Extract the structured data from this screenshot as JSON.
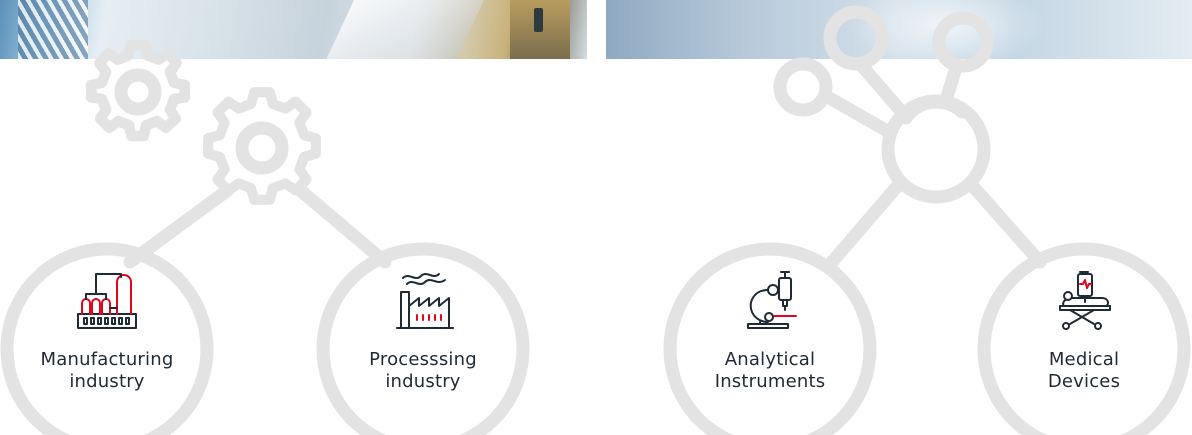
{
  "colors": {
    "ring": "#e3e3e3",
    "icon_stroke": "#1e2a35",
    "accent_red": "#e3051b",
    "text": "#1e2a35"
  },
  "categories": [
    {
      "line1": "Manufacturing",
      "line2": "industry",
      "icon": "manufacturing-plant-icon"
    },
    {
      "line1": "Processsing",
      "line2": "industry",
      "icon": "factory-smoke-icon"
    },
    {
      "line1": "Analytical",
      "line2": "Instruments",
      "icon": "microscope-icon"
    },
    {
      "line1": "Medical",
      "line2": "Devices",
      "icon": "hospital-bed-monitor-icon"
    }
  ],
  "decorations": [
    "gear-icon",
    "molecule-icon"
  ]
}
